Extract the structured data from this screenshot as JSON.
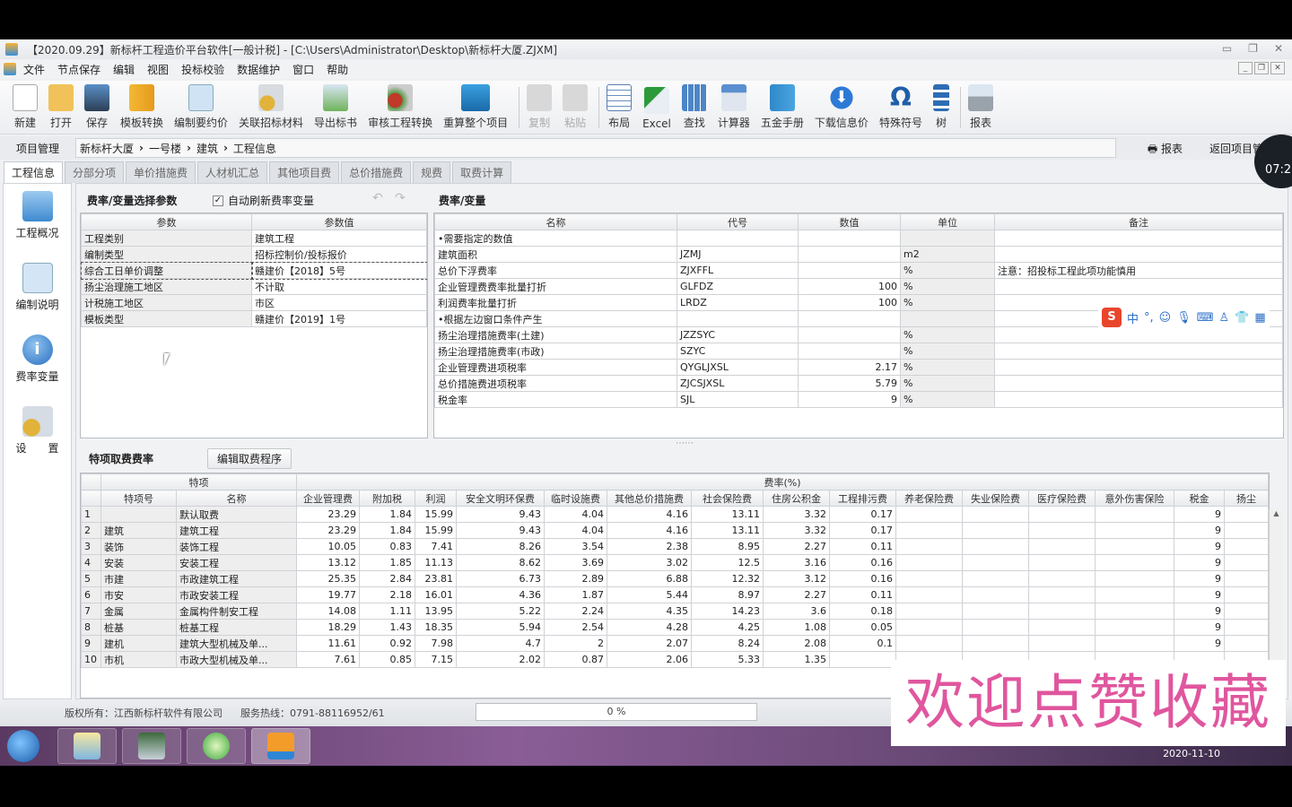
{
  "window": {
    "title": "【2020.09.29】新标杆工程造价平台软件[一般计税] - [C:\\Users\\Administrator\\Desktop\\新标杆大厦.ZJXM]",
    "controls": [
      "minimize",
      "restore",
      "close"
    ]
  },
  "menu": [
    "文件",
    "节点保存",
    "编辑",
    "视图",
    "投标校验",
    "数据维护",
    "窗口",
    "帮助"
  ],
  "toolbar": [
    {
      "label": "新建",
      "icon": "new-file-icon",
      "enabled": true
    },
    {
      "label": "打开",
      "icon": "open-folder-icon",
      "enabled": true
    },
    {
      "label": "保存",
      "icon": "save-disk-icon",
      "enabled": true
    },
    {
      "label": "模板转换",
      "icon": "template-convert-icon",
      "enabled": true
    },
    {
      "label": "编制要约价",
      "icon": "edit-document-icon",
      "enabled": true
    },
    {
      "label": "关联招标材料",
      "icon": "link-material-icon",
      "enabled": true
    },
    {
      "label": "导出标书",
      "icon": "export-bid-icon",
      "enabled": true
    },
    {
      "label": "审核工程转换",
      "icon": "audit-convert-icon",
      "enabled": true
    },
    {
      "label": "重算整个项目",
      "icon": "recalculate-monitor-icon",
      "enabled": true
    },
    {
      "label": "复制",
      "icon": "copy-icon",
      "enabled": false
    },
    {
      "label": "粘贴",
      "icon": "paste-icon",
      "enabled": false
    },
    {
      "label": "布局",
      "icon": "layout-grid-icon",
      "enabled": true
    },
    {
      "label": "Excel",
      "icon": "excel-icon",
      "enabled": true
    },
    {
      "label": "查找",
      "icon": "find-icon",
      "enabled": true
    },
    {
      "label": "计算器",
      "icon": "calculator-icon",
      "enabled": true
    },
    {
      "label": "五金手册",
      "icon": "handbook-icon",
      "enabled": true
    },
    {
      "label": "下载信息价",
      "icon": "download-arrow-icon",
      "enabled": true
    },
    {
      "label": "特殊符号",
      "icon": "omega-symbol-icon",
      "enabled": true
    },
    {
      "label": "树",
      "icon": "tree-icon",
      "enabled": true
    },
    {
      "label": "报表",
      "icon": "printer-icon",
      "enabled": true
    }
  ],
  "nav": {
    "project_manage": "项目管理",
    "breadcrumb": [
      "新标杆大厦",
      "一号楼",
      "建筑",
      "工程信息"
    ],
    "report": "报表",
    "back": "返回项目管理"
  },
  "tabs": [
    "工程信息",
    "分部分项",
    "单价措施费",
    "人材机汇总",
    "其他项目费",
    "总价措施费",
    "规费",
    "取费计算"
  ],
  "active_tab": "工程信息",
  "left_panel": [
    {
      "label": "工程概况",
      "icon": "overview-windows-icon"
    },
    {
      "label": "编制说明",
      "icon": "edit-note-icon"
    },
    {
      "label": "费率变量",
      "icon": "info-icon"
    },
    {
      "label": "设　　置",
      "icon": "settings-gear-icon"
    }
  ],
  "params_panel": {
    "title": "费率/变量选择参数",
    "auto_refresh_label": "自动刷新费率变量",
    "auto_refresh_checked": true,
    "columns": [
      "参数",
      "参数值"
    ],
    "rows": [
      [
        "工程类别",
        "建筑工程"
      ],
      [
        "编制类型",
        "招标控制价/投标报价"
      ],
      [
        "综合工日单价调整",
        "赣建价【2018】5号"
      ],
      [
        "扬尘治理施工地区",
        "不计取"
      ],
      [
        "计税施工地区",
        "市区"
      ],
      [
        "模板类型",
        "赣建价【2019】1号"
      ]
    ],
    "selected_row": 2
  },
  "rates_panel": {
    "title": "费率/变量",
    "columns": [
      "名称",
      "代号",
      "数值",
      "单位",
      "备注"
    ],
    "rows": [
      [
        "•需要指定的数值",
        "",
        "",
        "",
        ""
      ],
      [
        "建筑面积",
        "JZMJ",
        "",
        "m2",
        ""
      ],
      [
        "总价下浮费率",
        "ZJXFFL",
        "",
        "%",
        "注意：招投标工程此项功能慎用"
      ],
      [
        "企业管理费费率批量打折",
        "GLFDZ",
        "100",
        "%",
        ""
      ],
      [
        "利润费率批量打折",
        "LRDZ",
        "100",
        "%",
        ""
      ],
      [
        "•根据左边窗口条件产生",
        "",
        "",
        "",
        ""
      ],
      [
        "扬尘治理措施费率(土建)",
        "JZZSYC",
        "",
        "%",
        ""
      ],
      [
        "扬尘治理措施费率(市政)",
        "SZYC",
        "",
        "%",
        ""
      ],
      [
        "企业管理费进项税率",
        "QYGLJXSL",
        "2.17",
        "%",
        ""
      ],
      [
        "总价措施费进项税率",
        "ZJCSJXSL",
        "5.79",
        "%",
        ""
      ],
      [
        "税金率",
        "SJL",
        "9",
        "%",
        ""
      ]
    ]
  },
  "special_panel": {
    "title": "特项取费费率",
    "edit_button": "编辑取费程序",
    "group_headers": {
      "special": "特项",
      "rates": "费率(%)"
    },
    "columns": [
      "特项号",
      "名称",
      "企业管理费",
      "附加税",
      "利润",
      "安全文明环保费",
      "临时设施费",
      "其他总价措施费",
      "社会保险费",
      "住房公积金",
      "工程排污费",
      "养老保险费",
      "失业保险费",
      "医疗保险费",
      "意外伤害保险",
      "税金",
      "扬尘"
    ],
    "rows": [
      [
        "1",
        "",
        "默认取费",
        "23.29",
        "1.84",
        "15.99",
        "9.43",
        "4.04",
        "4.16",
        "13.11",
        "3.32",
        "0.17",
        "",
        "",
        "",
        "",
        "9",
        ""
      ],
      [
        "2",
        "建筑",
        "建筑工程",
        "23.29",
        "1.84",
        "15.99",
        "9.43",
        "4.04",
        "4.16",
        "13.11",
        "3.32",
        "0.17",
        "",
        "",
        "",
        "",
        "9",
        ""
      ],
      [
        "3",
        "装饰",
        "装饰工程",
        "10.05",
        "0.83",
        "7.41",
        "8.26",
        "3.54",
        "2.38",
        "8.95",
        "2.27",
        "0.11",
        "",
        "",
        "",
        "",
        "9",
        ""
      ],
      [
        "4",
        "安装",
        "安装工程",
        "13.12",
        "1.85",
        "11.13",
        "8.62",
        "3.69",
        "3.02",
        "12.5",
        "3.16",
        "0.16",
        "",
        "",
        "",
        "",
        "9",
        ""
      ],
      [
        "5",
        "市建",
        "市政建筑工程",
        "25.35",
        "2.84",
        "23.81",
        "6.73",
        "2.89",
        "6.88",
        "12.32",
        "3.12",
        "0.16",
        "",
        "",
        "",
        "",
        "9",
        ""
      ],
      [
        "6",
        "市安",
        "市政安装工程",
        "19.77",
        "2.18",
        "16.01",
        "4.36",
        "1.87",
        "5.44",
        "8.97",
        "2.27",
        "0.11",
        "",
        "",
        "",
        "",
        "9",
        ""
      ],
      [
        "7",
        "金属",
        "金属构件制安工程",
        "14.08",
        "1.11",
        "13.95",
        "5.22",
        "2.24",
        "4.35",
        "14.23",
        "3.6",
        "0.18",
        "",
        "",
        "",
        "",
        "9",
        ""
      ],
      [
        "8",
        "桩基",
        "桩基工程",
        "18.29",
        "1.43",
        "18.35",
        "5.94",
        "2.54",
        "4.28",
        "4.25",
        "1.08",
        "0.05",
        "",
        "",
        "",
        "",
        "9",
        ""
      ],
      [
        "9",
        "建机",
        "建筑大型机械及单...",
        "11.61",
        "0.92",
        "7.98",
        "4.7",
        "2",
        "2.07",
        "8.24",
        "2.08",
        "0.1",
        "",
        "",
        "",
        "",
        "9",
        ""
      ],
      [
        "10",
        "市机",
        "市政大型机械及单...",
        "7.61",
        "0.85",
        "7.15",
        "2.02",
        "0.87",
        "2.06",
        "5.33",
        "1.35",
        "",
        "",
        "",
        "",
        "",
        "",
        ""
      ]
    ]
  },
  "statusbar": {
    "copyright": "版权所有：江西新标杆软件有限公司",
    "hotline": "服务热线：0791-88116952/61",
    "progress_percent": 0,
    "progress_label": "0 %"
  },
  "overlay": {
    "watermark_text": "欢迎点赞收藏",
    "timer": "07:2"
  },
  "ime": {
    "mode": "中"
  },
  "taskbar": {
    "date": "2020-11-10"
  }
}
